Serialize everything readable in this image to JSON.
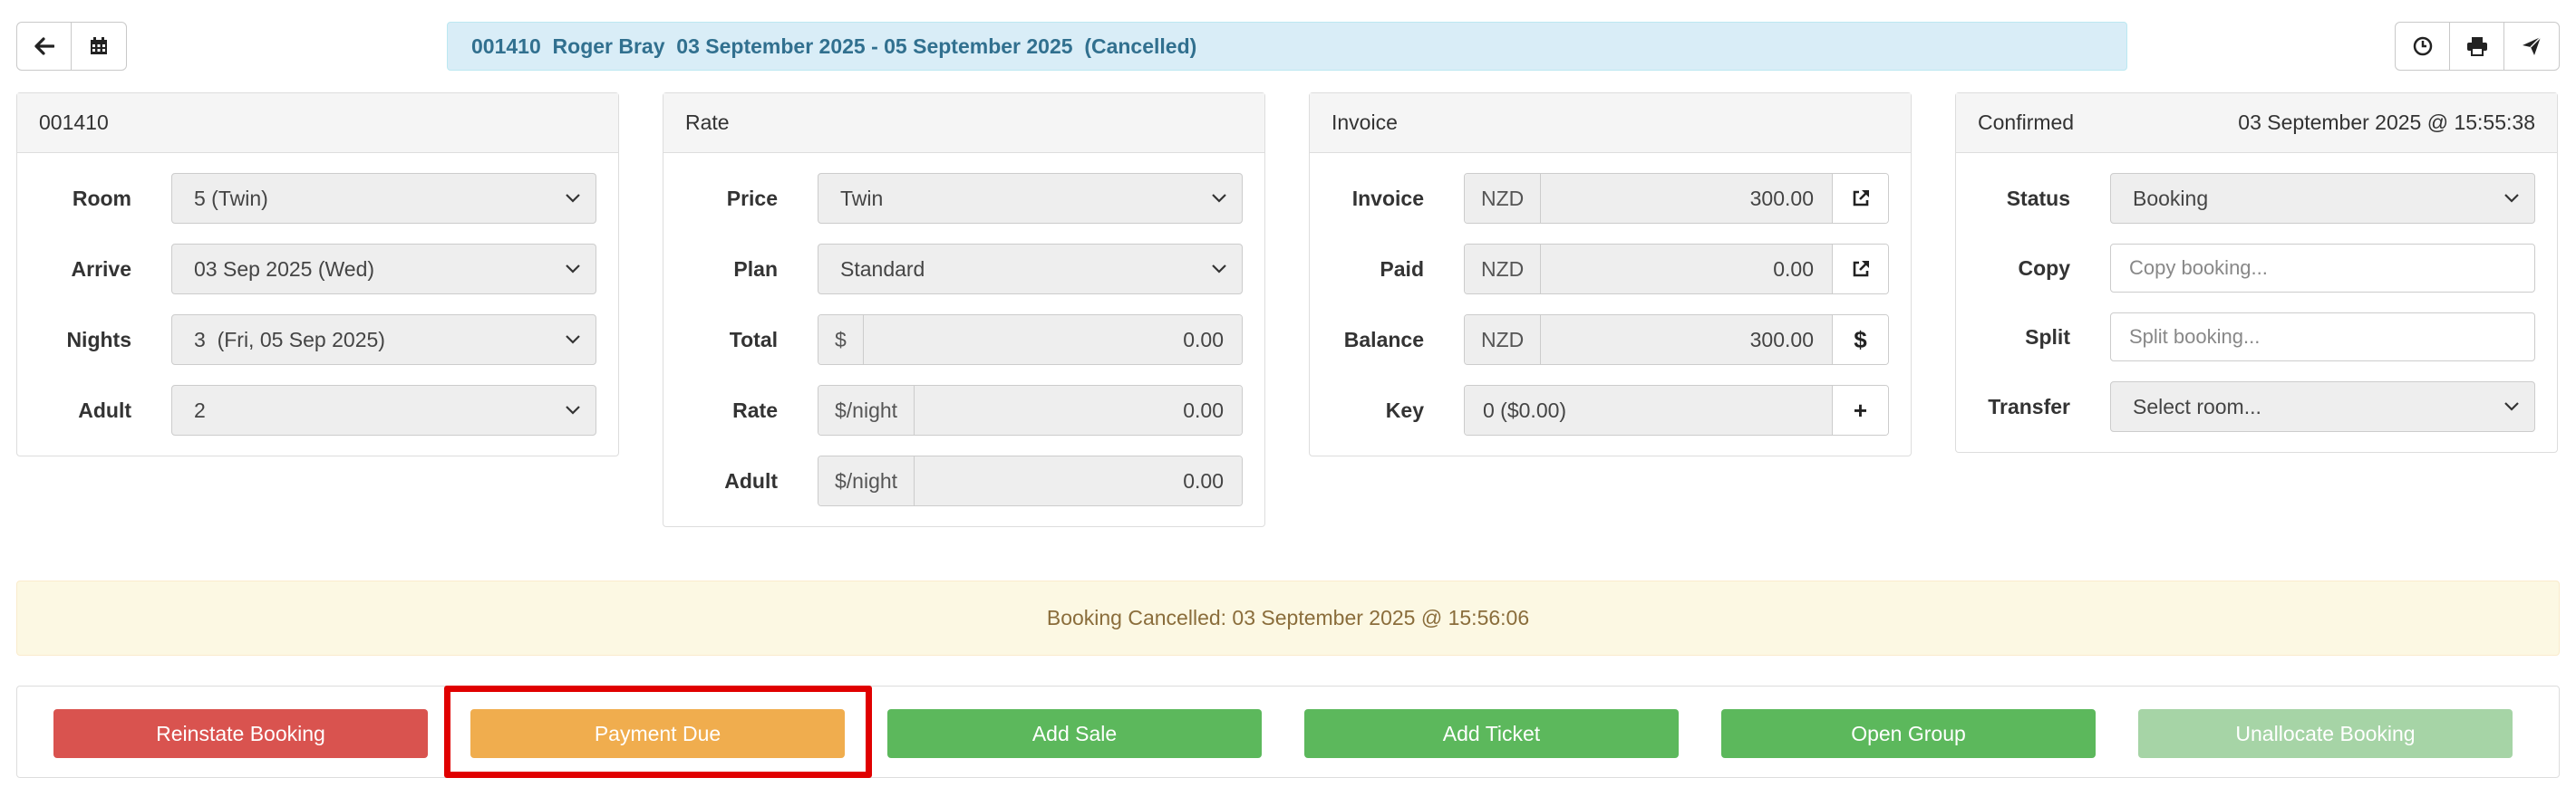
{
  "header": {
    "booking_title": "001410  Roger Bray  03 September 2025 - 05 September 2025  (Cancelled)"
  },
  "toolbar_left": [
    {
      "icon": "arrow-left-icon",
      "name": "back-button"
    },
    {
      "icon": "calendar-icon",
      "name": "calendar-button"
    }
  ],
  "toolbar_right": [
    {
      "icon": "clock-icon",
      "name": "history-button"
    },
    {
      "icon": "print-icon",
      "name": "print-button"
    },
    {
      "icon": "send-icon",
      "name": "send-button"
    }
  ],
  "booking_panel": {
    "title": "001410",
    "room_label": "Room",
    "room_value": "5 (Twin)",
    "arrive_label": "Arrive",
    "arrive_value": "03 Sep 2025 (Wed)",
    "nights_label": "Nights",
    "nights_value": "3  (Fri, 05 Sep 2025)",
    "adult_label": "Adult",
    "adult_value": "2"
  },
  "rate_panel": {
    "title": "Rate",
    "price_label": "Price",
    "price_value": "Twin",
    "plan_label": "Plan",
    "plan_value": "Standard",
    "total_label": "Total",
    "total_addon": "$",
    "total_value": "0.00",
    "rate_label": "Rate",
    "rate_addon": "$/night",
    "rate_value": "0.00",
    "adult_label": "Adult",
    "adult_addon": "$/night",
    "adult_value": "0.00"
  },
  "invoice_panel": {
    "title": "Invoice",
    "invoice_label": "Invoice",
    "invoice_currency": "NZD",
    "invoice_value": "300.00",
    "paid_label": "Paid",
    "paid_currency": "NZD",
    "paid_value": "0.00",
    "balance_label": "Balance",
    "balance_currency": "NZD",
    "balance_value": "300.00",
    "balance_button": "$",
    "key_label": "Key",
    "key_value": "0 ($0.00)",
    "key_button": "+"
  },
  "status_panel": {
    "title": "Confirmed",
    "timestamp": "03 September 2025 @ 15:55:38",
    "status_label": "Status",
    "status_value": "Booking",
    "copy_label": "Copy",
    "copy_placeholder": "Copy booking...",
    "split_label": "Split",
    "split_placeholder": "Split booking...",
    "transfer_label": "Transfer",
    "transfer_value": "Select room..."
  },
  "alert": {
    "text": "Booking Cancelled: 03 September 2025 @ 15:56:06"
  },
  "actions": {
    "reinstate": "Reinstate Booking",
    "payment_due": "Payment Due",
    "add_sale": "Add Sale",
    "add_ticket": "Add Ticket",
    "open_group": "Open Group",
    "unallocate": "Unallocate Booking"
  },
  "colors": {
    "banner_bg": "#d9edf7",
    "alert_bg": "#fcf8e3",
    "danger": "#d9534f",
    "warning": "#f0ad4e",
    "success": "#5cb85c",
    "highlight": "#e00000"
  }
}
